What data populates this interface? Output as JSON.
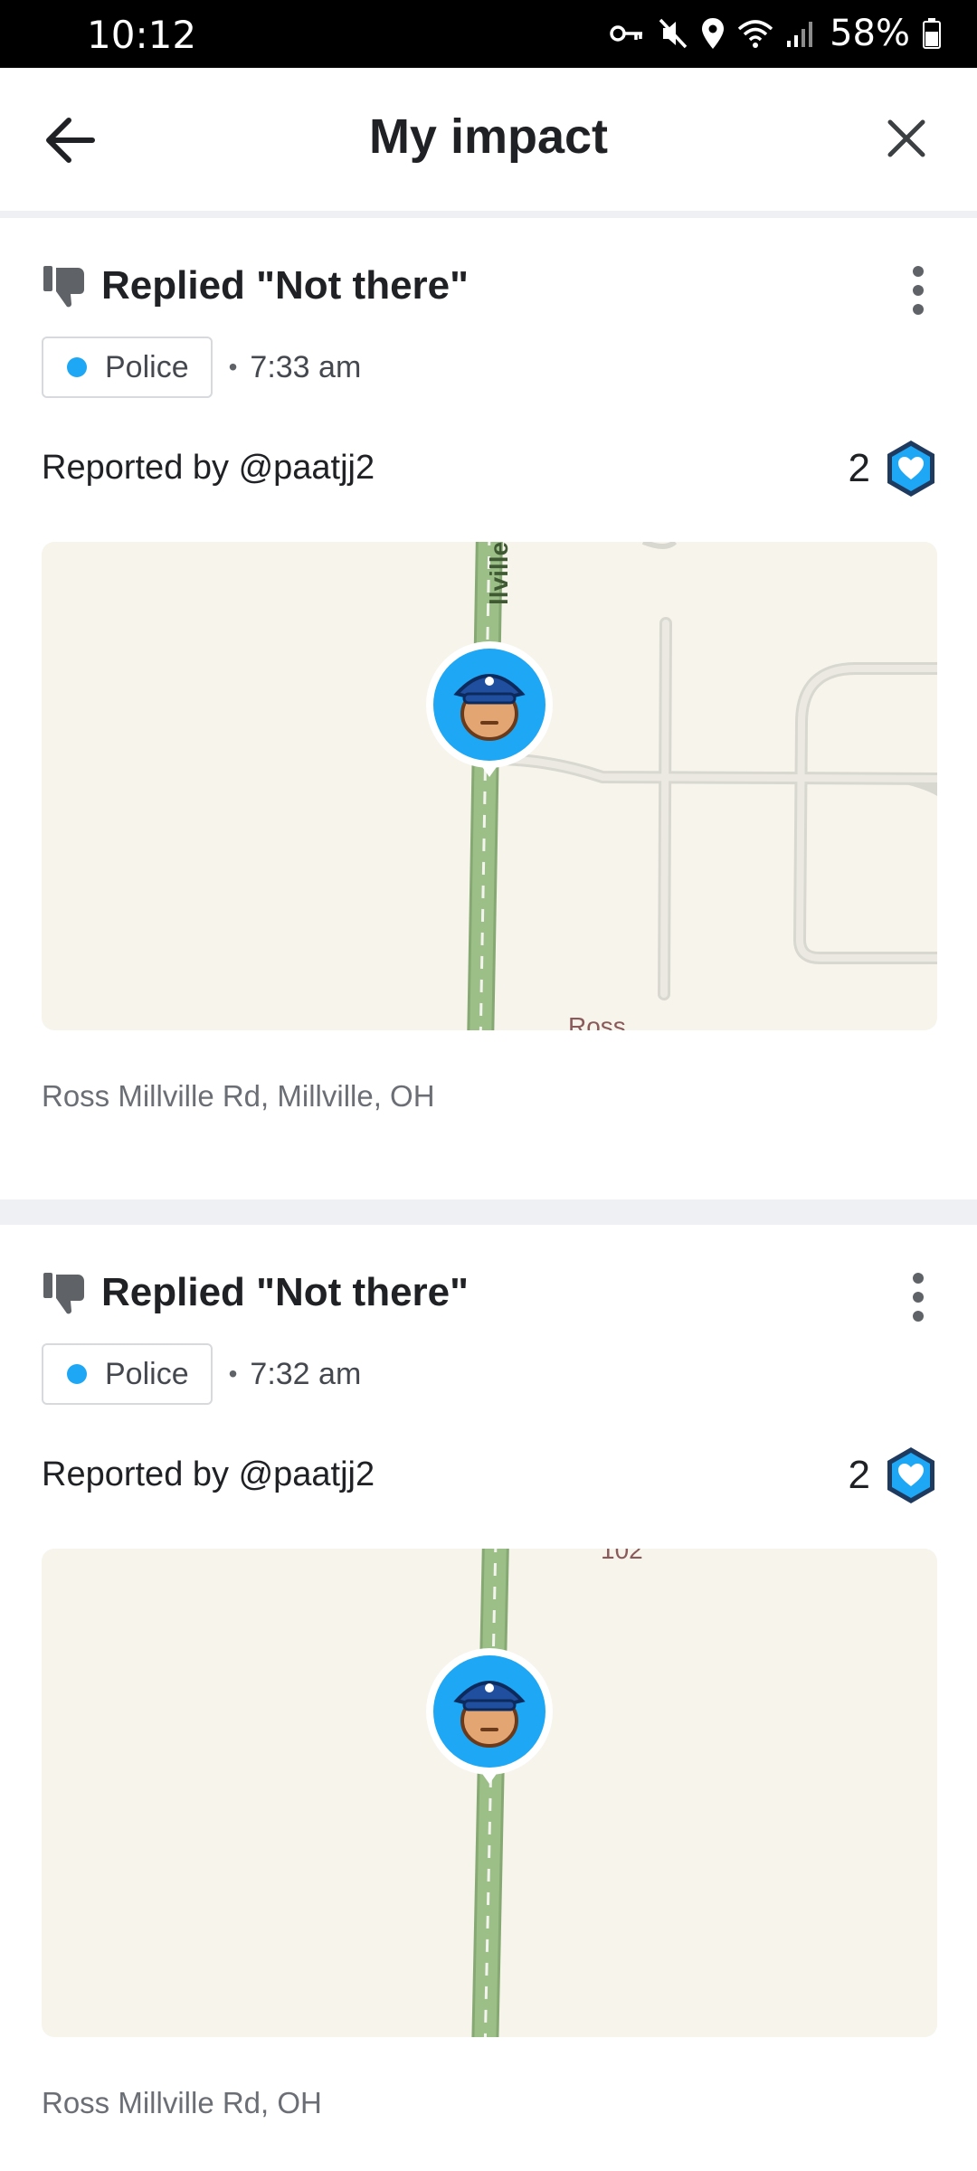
{
  "status_bar": {
    "time": "10:12",
    "battery_percent": "58%",
    "icons": [
      "vpn-key-icon",
      "mute-icon",
      "location-icon",
      "wifi-icon",
      "signal-icon",
      "battery-icon"
    ]
  },
  "header": {
    "title": "My impact",
    "back_icon": "arrow-left-icon",
    "close_icon": "close-icon"
  },
  "cards": [
    {
      "activity": "Replied \"Not there\"",
      "icon": "thumbs-down-icon",
      "tag_label": "Police",
      "time": "7:33 am",
      "reporter": "Reported by @paatjj2",
      "thanks_count": "2",
      "map": {
        "road_label": "llville R",
        "bottom_label": "Ross"
      },
      "address": "Ross Millville Rd, Millville, OH"
    },
    {
      "activity": "Replied \"Not there\"",
      "icon": "thumbs-down-icon",
      "tag_label": "Police",
      "time": "7:32 am",
      "reporter": "Reported by @paatjj2",
      "thanks_count": "2",
      "map": {
        "top_label": "102"
      },
      "address": "Ross Millville Rd, OH"
    }
  ],
  "colors": {
    "accent_blue": "#1ea7f5",
    "road_green": "#9bbf87",
    "map_background": "#f7f4ec",
    "separator": "#eef0f3"
  }
}
